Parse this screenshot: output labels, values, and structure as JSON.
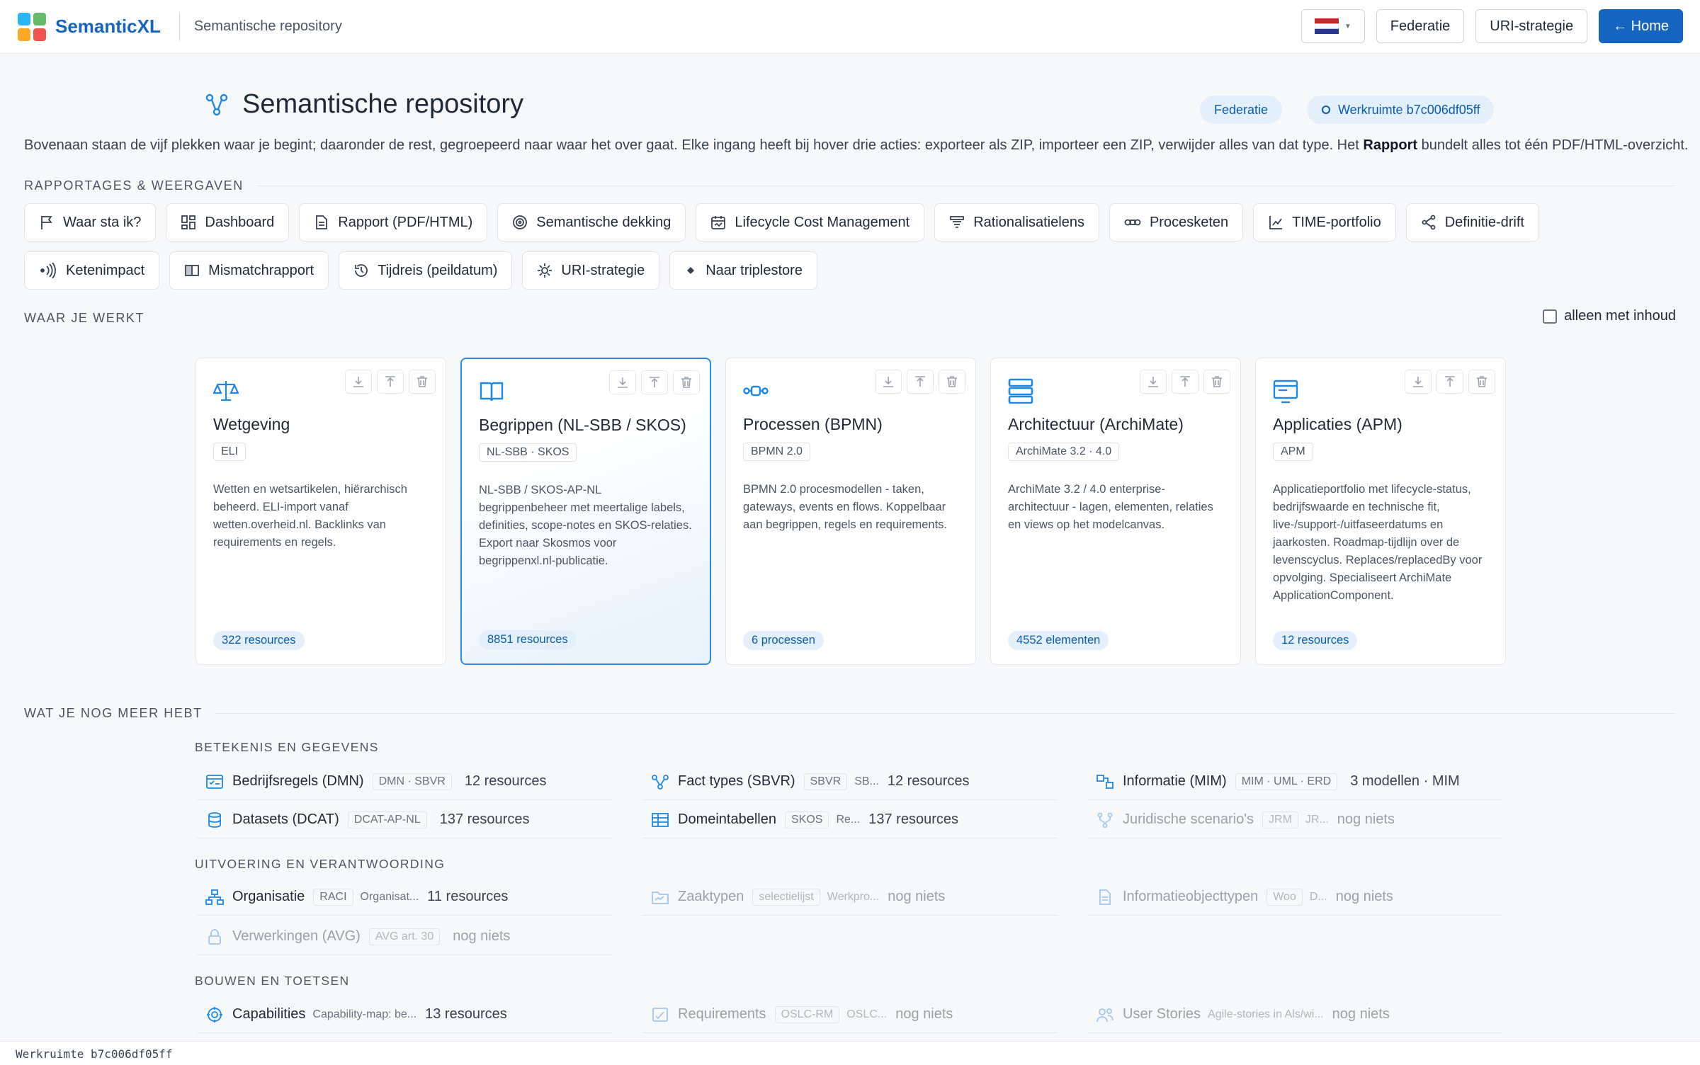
{
  "app": {
    "name": "SemanticXL",
    "subtitle": "Semantische repository"
  },
  "topnav": {
    "lang_flag": "NL",
    "federatie": "Federatie",
    "uri": "URI-strategie",
    "home": "← Home"
  },
  "page": {
    "title": "Semantische repository",
    "pill_federatie": "Federatie",
    "pill_workspace": "Werkruimte b7c006df05ff",
    "intro_before": "Bovenaan staan de vijf plekken waar je begint; daaronder de rest, gegroepeerd naar waar het over gaat. Elke ingang heeft bij hover drie acties: exporteer als ZIP, importeer een ZIP, verwijder alles van dat type. Het ",
    "intro_bold": "Rapport",
    "intro_after": " bundelt alles tot één PDF/HTML-overzicht."
  },
  "sections": {
    "reports": "RAPPORTAGES & WEERGAVEN",
    "work": "WAAR JE WERKT",
    "more": "WAT JE NOG MEER HEBT",
    "filter_label": "alleen met inhoud"
  },
  "reports": [
    {
      "label": "Waar sta ik?",
      "icon": "flag-icon"
    },
    {
      "label": "Dashboard",
      "icon": "dashboard-icon"
    },
    {
      "label": "Rapport (PDF/HTML)",
      "icon": "document-icon"
    },
    {
      "label": "Semantische dekking",
      "icon": "target-icon"
    },
    {
      "label": "Lifecycle Cost Management",
      "icon": "calendar-icon"
    },
    {
      "label": "Rationalisatielens",
      "icon": "filter-icon"
    },
    {
      "label": "Procesketen",
      "icon": "chain-icon"
    },
    {
      "label": "TIME-portfolio",
      "icon": "chart-icon"
    },
    {
      "label": "Definitie-drift",
      "icon": "share-icon"
    },
    {
      "label": "Ketenimpact",
      "icon": "broadcast-icon"
    },
    {
      "label": "Mismatchrapport",
      "icon": "columns-icon"
    },
    {
      "label": "Tijdreis (peildatum)",
      "icon": "history-icon"
    },
    {
      "label": "URI-strategie",
      "icon": "sun-icon"
    },
    {
      "label": "Naar triplestore",
      "icon": "diamond-icon"
    }
  ],
  "cards": [
    {
      "title": "Wetgeving",
      "tag": "ELI",
      "desc": "Wetten en wetsartikelen, hiërarchisch beheerd. ELI-import vanaf wetten.overheid.nl. Backlinks van requirements en regels.",
      "count": "322 resources",
      "icon": "scale-icon"
    },
    {
      "title": "Begrippen (NL-SBB / SKOS)",
      "tag": "NL-SBB · SKOS",
      "desc": "NL-SBB / SKOS-AP-NL begrippenbeheer met meertalige labels, definities, scope-notes en SKOS-relaties. Export naar Skosmos voor begrippenxl.nl-publicatie.",
      "count": "8851 resources",
      "icon": "book-icon"
    },
    {
      "title": "Processen (BPMN)",
      "tag": "BPMN 2.0",
      "desc": "BPMN 2.0 procesmodellen - taken, gateways, events en flows. Koppelbaar aan begrippen, regels en requirements.",
      "count": "6 processen",
      "icon": "process-icon"
    },
    {
      "title": "Architectuur (ArchiMate)",
      "tag": "ArchiMate 3.2 · 4.0",
      "desc": "ArchiMate 3.2 / 4.0 enterprise-architectuur - lagen, elementen, relaties en views op het modelcanvas.",
      "count": "4552 elementen",
      "icon": "layers-icon"
    },
    {
      "title": "Applicaties (APM)",
      "tag": "APM",
      "desc": "Applicatieportfolio met lifecycle-status, bedrijfswaarde en technische fit, live-/support-/uitfaseerdatums en jaarkosten. Roadmap-tijdlijn over de levenscyclus. Replaces/replacedBy voor opvolging. Specialiseert ArchiMate ApplicationComponent.",
      "count": "12 resources",
      "icon": "monitor-icon"
    }
  ],
  "groups": [
    {
      "label": "BETEKENIS EN GEGEVENS",
      "items": [
        {
          "name": "Bedrijfsregels (DMN)",
          "tag": "DMN · SBVR",
          "sub": "",
          "count": "12 resources",
          "dim": false,
          "icon": "rules-icon"
        },
        {
          "name": "Fact types (SBVR)",
          "tag": "SBVR",
          "sub": "SB...",
          "count": "12 resources",
          "dim": false,
          "icon": "graph-icon"
        },
        {
          "name": "Informatie (MIM)",
          "tag": "MIM · UML · ERD",
          "sub": "",
          "count": "3 modellen · MIM",
          "dim": false,
          "icon": "model-icon"
        },
        {
          "name": "Datasets (DCAT)",
          "tag": "DCAT-AP-NL",
          "sub": "",
          "count": "137 resources",
          "dim": false,
          "icon": "database-icon"
        },
        {
          "name": "Domeintabellen",
          "tag": "SKOS",
          "sub": "Re...",
          "count": "137 resources",
          "dim": false,
          "icon": "table-icon"
        },
        {
          "name": "Juridische scenario's",
          "tag": "JRM",
          "sub": "JR...",
          "count": "nog niets",
          "dim": true,
          "icon": "branch-icon"
        }
      ]
    },
    {
      "label": "UITVOERING EN VERANTWOORDING",
      "items": [
        {
          "name": "Organisatie",
          "tag": "RACI",
          "sub": "Organisat...",
          "count": "11 resources",
          "dim": false,
          "icon": "org-icon"
        },
        {
          "name": "Zaaktypen",
          "tag": "selectielijst",
          "sub": "Werkpro...",
          "count": "nog niets",
          "dim": true,
          "icon": "folder-icon"
        },
        {
          "name": "Informatieobjecttypen",
          "tag": "Woo",
          "sub": "D...",
          "count": "nog niets",
          "dim": true,
          "icon": "file-icon"
        },
        {
          "name": "Verwerkingen (AVG)",
          "tag": "AVG art. 30",
          "sub": "",
          "count": "nog niets",
          "dim": true,
          "icon": "lock-icon"
        }
      ]
    },
    {
      "label": "BOUWEN EN TOETSEN",
      "items": [
        {
          "name": "Capabilities",
          "tag": "",
          "sub": "Capability-map: be...",
          "count": "13 resources",
          "dim": false,
          "icon": "capability-icon"
        },
        {
          "name": "Requirements",
          "tag": "OSLC-RM",
          "sub": "OSLC...",
          "count": "nog niets",
          "dim": true,
          "icon": "checklist-icon"
        },
        {
          "name": "User Stories",
          "tag": "",
          "sub": "Agile-stories in Als/wi...",
          "count": "nog niets",
          "dim": true,
          "icon": "users-icon"
        }
      ]
    }
  ],
  "status": {
    "workspace": "Werkruimte b7c006df05ff"
  },
  "colors": {
    "accent": "#1565c0",
    "icon_blue": "#1e88e5",
    "pill_bg": "#e3f0fc"
  }
}
